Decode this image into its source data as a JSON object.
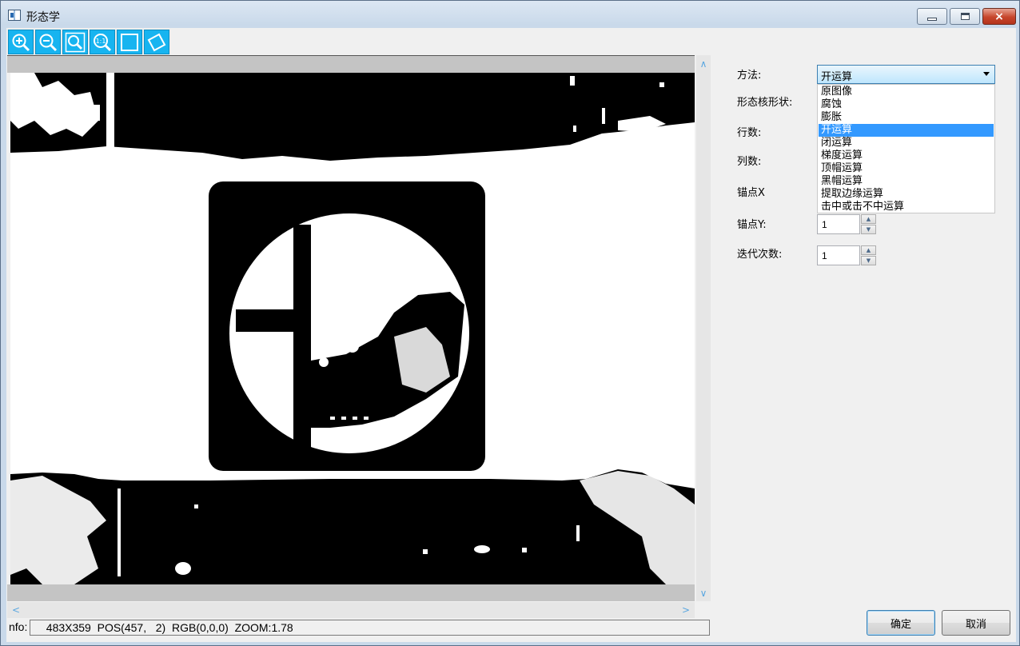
{
  "window": {
    "title": "形态学",
    "buttons": {
      "minimize": "minimize",
      "maximize": "maximize",
      "close": "×"
    }
  },
  "toolbar": {
    "tools": [
      {
        "name": "zoom-in-icon"
      },
      {
        "name": "zoom-out-icon"
      },
      {
        "name": "zoom-fit-icon"
      },
      {
        "name": "zoom-actual-size-icon",
        "glyph": "1:1"
      },
      {
        "name": "rectangle-roi-icon"
      },
      {
        "name": "rotated-rectangle-roi-icon"
      }
    ],
    "accent": "#17b4f0"
  },
  "image_view": {
    "width": 483,
    "height": 359
  },
  "status": {
    "prefix": "nfo:",
    "text": "  483X359  POS(457,   2)  RGB(0,0,0)  ZOOM:1.78"
  },
  "form": {
    "method_label": "方法:",
    "kernel_shape_label": "形态核形状:",
    "rows_label": "行数:",
    "cols_label": "列数:",
    "anchor_x_label": "锚点X",
    "anchor_y_label": "锚点Y:",
    "iterations_label": "迭代次数:",
    "anchor_y_value": "1",
    "iterations_value": "1"
  },
  "method_combo": {
    "selected": "开运算",
    "options": [
      "原图像",
      "腐蚀",
      "膨胀",
      "开运算",
      "闭运算",
      "梯度运算",
      "顶帽运算",
      "黑帽运算",
      "提取边缘运算",
      "击中或击不中运算"
    ],
    "selected_index": 3
  },
  "buttons": {
    "ok": "确定",
    "cancel": "取消"
  }
}
